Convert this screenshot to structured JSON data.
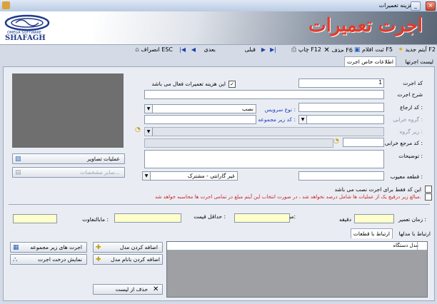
{
  "window": {
    "title": "هزینه تعمیرات",
    "min": "_",
    "max": "□",
    "close": "×"
  },
  "banner": {
    "title": "اجرت تعمیرات",
    "logo_text": "OMEGA SOFTWARE",
    "logo_brand": "SHAFAGH"
  },
  "toolbar": {
    "new": "آیتم جدید  F2",
    "save": "ثبت اقلام  F5",
    "delete": "حذف  F6",
    "print": "چاپ  F12",
    "prev": "قبلی",
    "next": "بعدی",
    "cancel": "انصراف ESC"
  },
  "tabs": {
    "list": "لیست اجرتها",
    "info": "اطلاعات خاص اجرت"
  },
  "form": {
    "code_label": "کد اجرت",
    "code_value": "1",
    "active_check_label": "این هزینه تعمیرات  فعال می باشد",
    "desc_label": "شرح اجرت",
    "ref_label": "کد ارجاع :",
    "service_type_label": "نوع سرویس :",
    "service_type_value": "نصب",
    "fault_group_label": "گروه خرابی :",
    "subset_label": "کد زیر مجموعه :",
    "subgroup_label": "زیر گروه :",
    "fault_ref_label": "کد مرجع خرابی :",
    "notes_label": "توضیحات :",
    "part_label": "قطعه معیوب :",
    "warranty_value": "غیر گارانتی - مشترک",
    "install_only_label": "این کد فقط برای اجرت نصب می باشد",
    "note_red": "مبالغ زیر درقیچ یک از عملیات ها شامل درصد نخواهد شد ، در صورت انتخاب این آیتم مبلغ در تمامی اجرت ها محاسبه خواهد شد."
  },
  "side": {
    "images_button": "عملیات تصاویر",
    "other_button": "سایر مشخصات..."
  },
  "fields_row": {
    "repair_time_label": "زمان تعمیر :",
    "minute_label": "دقیقه",
    "amount_label": "مبلغ:",
    "min_price_label": "حداقل قیمت :",
    "diff_label": "مابالتفاوت :"
  },
  "lower_tabs": {
    "parts": "ارتباط با قطعات",
    "models": "ارتباط با مدلها"
  },
  "grid": {
    "column": "مدل دستگاه"
  },
  "actions": {
    "add_model": "اضافه کردن مدل",
    "add_model_by_name": "اضافه کردن بانام مدل",
    "remove_from_list": "حذف از لیست",
    "sub_items": "اجرت های زیر مجموعه",
    "show_tree": "نمایش درخت اجرت"
  },
  "colors": {
    "accent_red": "#e23b2a",
    "label_blue": "#1a3cbf",
    "yellow_field": "#ffffcc"
  }
}
